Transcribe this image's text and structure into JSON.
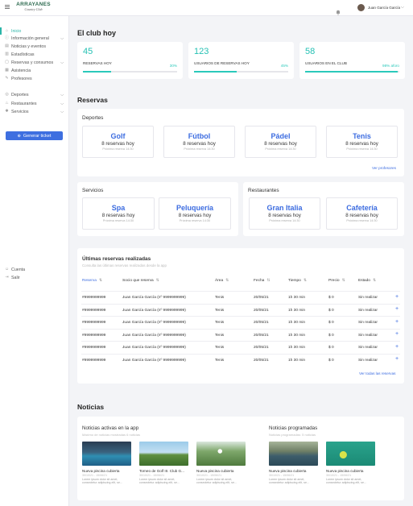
{
  "brand": {
    "name": "ARRAYANES",
    "subtitle": "Country Club"
  },
  "header": {
    "user_name": "Juan García García"
  },
  "sidebar": {
    "items": [
      {
        "label": "Inicio",
        "icon": "home-icon",
        "active": true
      },
      {
        "label": "Información general",
        "icon": "info-icon",
        "chevron": true
      },
      {
        "label": "Noticias y eventos",
        "icon": "news-icon"
      },
      {
        "label": "Estadísticas",
        "icon": "stats-icon"
      },
      {
        "label": "Reservas y consumos",
        "icon": "bookings-icon",
        "chevron": true
      },
      {
        "label": "Asistencia",
        "icon": "calendar-icon"
      },
      {
        "label": "Profesores",
        "icon": "teacher-icon"
      },
      {
        "label": "Deportes",
        "icon": "sports-icon",
        "chevron": true
      },
      {
        "label": "Restaurantes",
        "icon": "restaurant-icon",
        "chevron": true
      },
      {
        "label": "Servicios",
        "icon": "services-icon",
        "chevron": true
      }
    ],
    "generate_button": "Generar ticket",
    "bottom": [
      {
        "label": "Cuenta",
        "icon": "user-icon"
      },
      {
        "label": "Salir",
        "icon": "logout-icon"
      }
    ]
  },
  "club": {
    "title": "El club hoy",
    "stats": [
      {
        "value": "45",
        "label": "RESERVAS HOY",
        "percent_text": "30%",
        "progress": 0.3
      },
      {
        "value": "123",
        "label": "USUARIOS DE RESERVAS HOY",
        "percent_text": "45%",
        "progress": 0.45
      },
      {
        "value": "58",
        "label": "USUARIOS EN EL CLUB",
        "percent_text": "98% aforo",
        "progress": 0.98
      }
    ]
  },
  "reservas": {
    "title": "Reservas",
    "deportes": {
      "title": "Deportes",
      "items": [
        {
          "name": "Golf",
          "count": "8 reservas hoy",
          "next": "Próxima reserva 14:30"
        },
        {
          "name": "Fútbol",
          "count": "8 reservas hoy",
          "next": "Próxima reserva 14:30"
        },
        {
          "name": "Pádel",
          "count": "8 reservas hoy",
          "next": "Próxima reserva 14:30"
        },
        {
          "name": "Tenis",
          "count": "8 reservas hoy",
          "next": "Próxima reserva 14:30"
        }
      ],
      "link": "Ver profesores"
    },
    "servicios": {
      "title": "Servicios",
      "items": [
        {
          "name": "Spa",
          "count": "8 reservas hoy",
          "next": "Próxima reserva 14:30"
        },
        {
          "name": "Peluquería",
          "count": "8 reservas hoy",
          "next": "Próxima reserva 14:30"
        }
      ]
    },
    "restaurantes": {
      "title": "Restaurantes",
      "items": [
        {
          "name": "Gran Italia",
          "count": "8 reservas hoy",
          "next": "Próxima reserva 14:30"
        },
        {
          "name": "Cafetería",
          "count": "8 reservas hoy",
          "next": "Próxima reserva 14:30"
        }
      ]
    }
  },
  "ultimas": {
    "title": "Últimas reservas realizadas",
    "subtitle": "Consulta las últimas reservas realizadas desde la app",
    "columns": [
      "Reserva",
      "Socio que reserva",
      "Área",
      "Fecha",
      "Tiempo",
      "Precio",
      "Estado"
    ],
    "rows": [
      [
        "#9999999999",
        "Juan García García (nº 9999999999)",
        "Tenis",
        "20/05/21",
        "1h 30 min",
        "$ 0",
        "Sin realizar"
      ],
      [
        "#9999999999",
        "Juan García García (nº 9999999999)",
        "Tenis",
        "20/05/21",
        "1h 30 min",
        "$ 0",
        "Sin realizar"
      ],
      [
        "#9999999999",
        "Juan García García (nº 9999999999)",
        "Tenis",
        "20/05/21",
        "1h 30 min",
        "$ 0",
        "Sin realizar"
      ],
      [
        "#9999999999",
        "Juan García García (nº 9999999999)",
        "Tenis",
        "20/05/21",
        "1h 30 min",
        "$ 0",
        "Sin realizar"
      ],
      [
        "#9999999999",
        "Juan García García (nº 9999999999)",
        "Tenis",
        "20/05/21",
        "1h 30 min",
        "$ 0",
        "Sin realizar"
      ],
      [
        "#9999999999",
        "Juan García García (nº 9999999999)",
        "Tenis",
        "20/05/21",
        "1h 30 min",
        "$ 0",
        "Sin realizar"
      ]
    ],
    "link": "Ver todas las reservas"
  },
  "noticias": {
    "title": "Noticias",
    "activas": {
      "title": "Noticias activas en la app",
      "subtitle": "Máximo de noticias mostradas 6 noticias",
      "items": [
        {
          "title": "Nueva piscina cubierta",
          "date": "30/10/21 - 15/06/21",
          "text": "Lorem ipsum dolor sit amet, consectetur adipiscing elit, se..."
        },
        {
          "title": "Torneo de Golf III. Club G...",
          "date": "30/10/21 - 15/06/21",
          "text": "Lorem ipsum dolor sit amet, consectetur adipiscing elit, se..."
        },
        {
          "title": "Nueva piscina cubierta",
          "date": "30/10/21 - 15/06/21",
          "text": "Lorem ipsum dolor sit amet, consectetur adipiscing elit, se..."
        }
      ]
    },
    "programadas": {
      "title": "Noticias programadas",
      "subtitle": "Noticias programadas: 5 noticias",
      "items": [
        {
          "title": "Nueva piscina cubierta",
          "date": "30/10/21 - 15/06/21",
          "text": "Lorem ipsum dolor sit amet, consectetur adipiscing elit, se..."
        },
        {
          "title": "Nueva piscina cubierta",
          "date": "30/10/21 - 15/06/21",
          "text": "Lorem ipsum dolor sit amet, consectetur adipiscing elit, se..."
        }
      ]
    }
  },
  "colors": {
    "accent": "#2bc9bb",
    "primary": "#3c6ce0"
  }
}
